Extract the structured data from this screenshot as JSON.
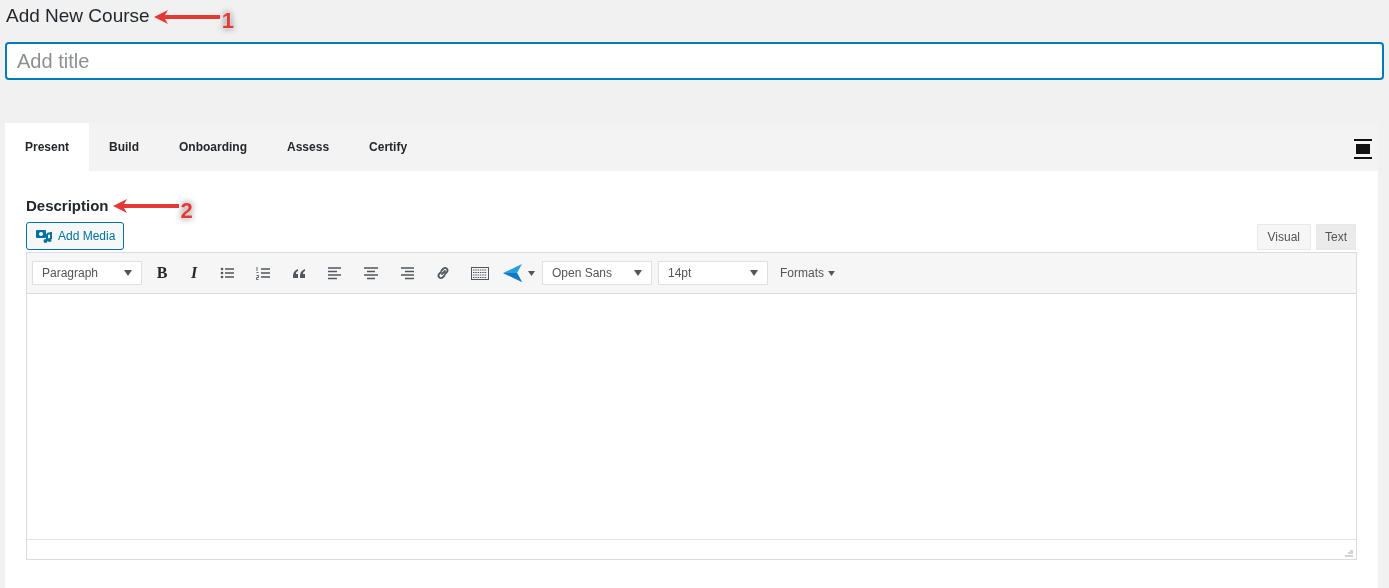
{
  "page_title": "Add New Course",
  "callouts": [
    {
      "number": "1"
    },
    {
      "number": "2"
    }
  ],
  "title_field": {
    "placeholder": "Add title"
  },
  "tabs": [
    {
      "label": "Present",
      "selected": true
    },
    {
      "label": "Build",
      "selected": false
    },
    {
      "label": "Onboarding",
      "selected": false
    },
    {
      "label": "Assess",
      "selected": false
    },
    {
      "label": "Certify",
      "selected": false
    }
  ],
  "description": {
    "heading": "Description",
    "add_media": "Add Media"
  },
  "editor_modes": [
    {
      "label": "Visual",
      "selected": true
    },
    {
      "label": "Text",
      "selected": false
    }
  ],
  "toolbar": [
    {
      "kind": "select",
      "value": "Paragraph"
    },
    {
      "kind": "bold",
      "label": "B"
    },
    {
      "kind": "italic",
      "label": "I"
    },
    {
      "kind": "bullets"
    },
    {
      "kind": "numbers"
    },
    {
      "kind": "quote"
    },
    {
      "kind": "align-left"
    },
    {
      "kind": "align-center"
    },
    {
      "kind": "align-right"
    },
    {
      "kind": "link"
    },
    {
      "kind": "keyboard"
    },
    {
      "kind": "plugin"
    },
    {
      "kind": "select",
      "value": "Open Sans"
    },
    {
      "kind": "select",
      "value": "14pt"
    },
    {
      "kind": "menu",
      "label": "Formats"
    }
  ]
}
